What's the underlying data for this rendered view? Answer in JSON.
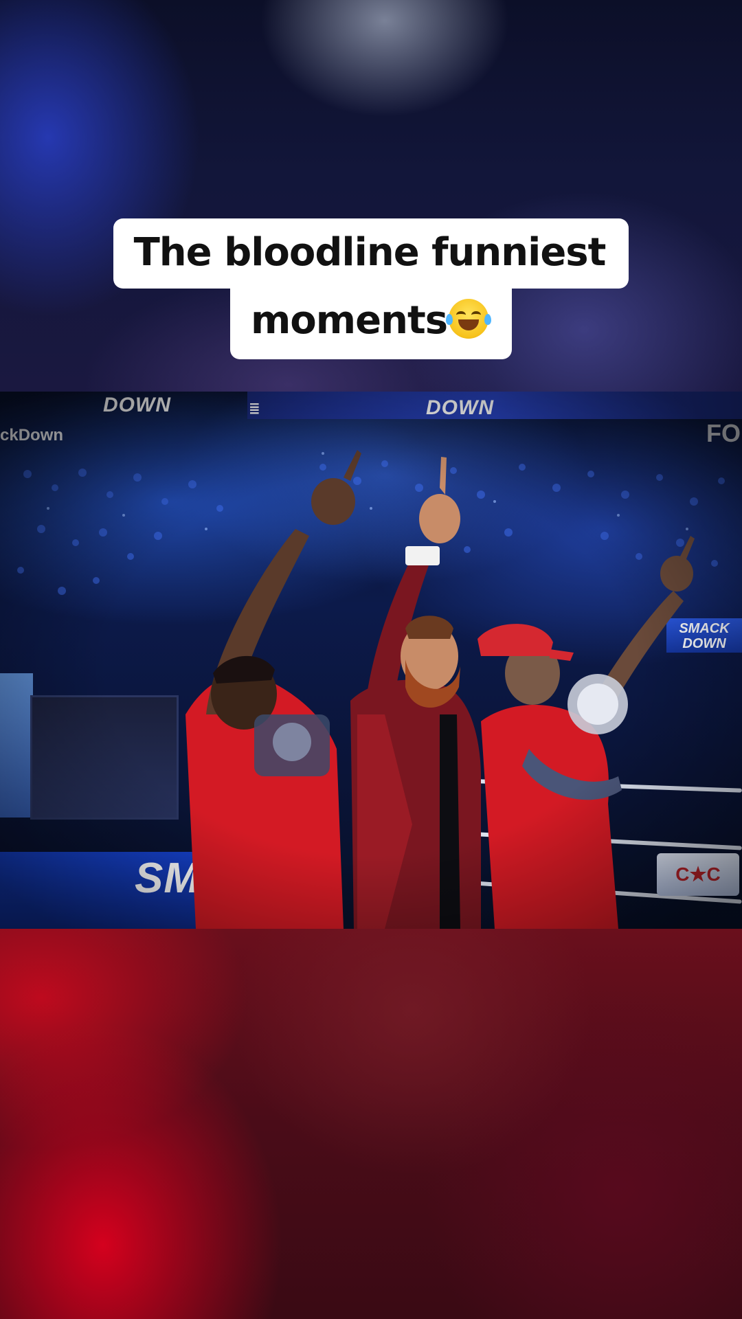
{
  "caption": {
    "line1": "The bloodline funniest",
    "line2": "moments",
    "emoji": "face-with-tears-of-joy"
  },
  "video": {
    "banner_text_1": "DOWN",
    "banner_text_2": "DOWN",
    "corner_left": "ckDown",
    "corner_right": "FO",
    "screen_right_text": "SMACK DOWN",
    "apron_text": "SMA",
    "badge_right_text": "C★C"
  },
  "colors": {
    "caption_bg": "#ffffff",
    "caption_text": "#111111",
    "accent_blue": "#2a46c8",
    "shirt_red": "#d31a24",
    "backdrop_red": "#c4001c"
  }
}
